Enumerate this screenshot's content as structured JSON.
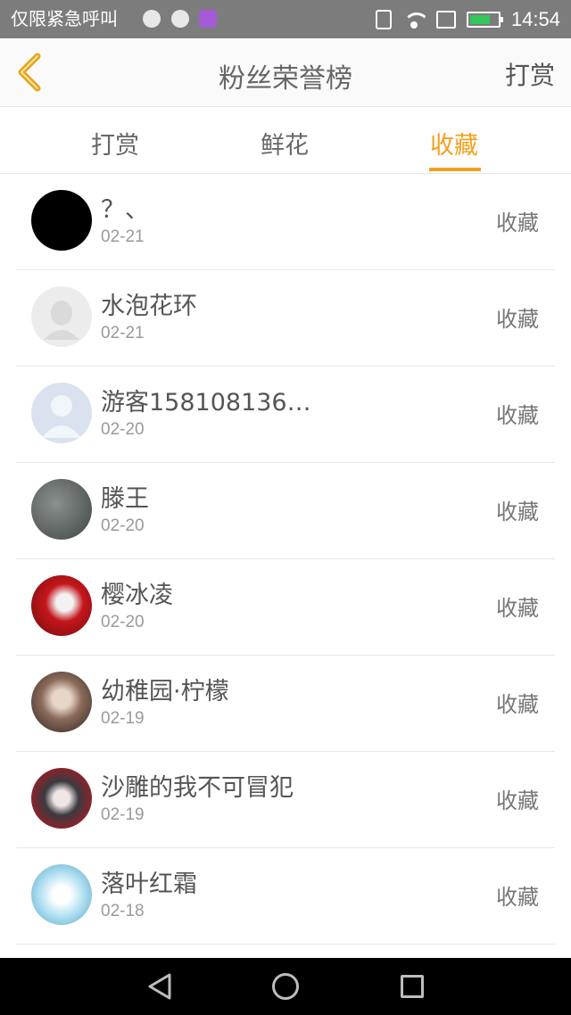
{
  "status_bar": {
    "carrier_text": "仅限紧急呼叫",
    "time": "14:54",
    "icons": [
      "notification-icon-1",
      "notification-icon-2",
      "notification-icon-3",
      "vibrate-icon",
      "wifi-icon",
      "sim-icon",
      "battery-charging-icon"
    ]
  },
  "header": {
    "title": "粉丝荣誉榜",
    "right_action": "打赏",
    "back_icon": "chevron-left-icon",
    "accent_color": "#f4a11f"
  },
  "tabs": [
    {
      "label": "打赏",
      "active": false
    },
    {
      "label": "鲜花",
      "active": false
    },
    {
      "label": "收藏",
      "active": true
    }
  ],
  "list": [
    {
      "name": "？、",
      "date": "02-21",
      "type": "收藏",
      "avatar_color": "#000000"
    },
    {
      "name": "水泡花环",
      "date": "02-21",
      "type": "收藏",
      "avatar_color": "#e6e6e6"
    },
    {
      "name": "游客1581081368…",
      "date": "02-20",
      "type": "收藏",
      "avatar_color": "#d6dde8"
    },
    {
      "name": "滕王",
      "date": "02-20",
      "type": "收藏",
      "avatar_color": "#5a6160"
    },
    {
      "name": "樱冰凌",
      "date": "02-20",
      "type": "收藏",
      "avatar_color": "#b01e1e"
    },
    {
      "name": "幼稚园·柠檬",
      "date": "02-19",
      "type": "收藏",
      "avatar_color": "#7d5a4a"
    },
    {
      "name": "沙雕的我不可冒犯",
      "date": "02-19",
      "type": "收藏",
      "avatar_color": "#2f2f33"
    },
    {
      "name": "落叶红霜",
      "date": "02-18",
      "type": "收藏",
      "avatar_color": "#9fd3e6"
    }
  ],
  "nav_bar": {
    "icons": [
      "nav-back-icon",
      "nav-home-icon",
      "nav-recent-icon"
    ]
  }
}
